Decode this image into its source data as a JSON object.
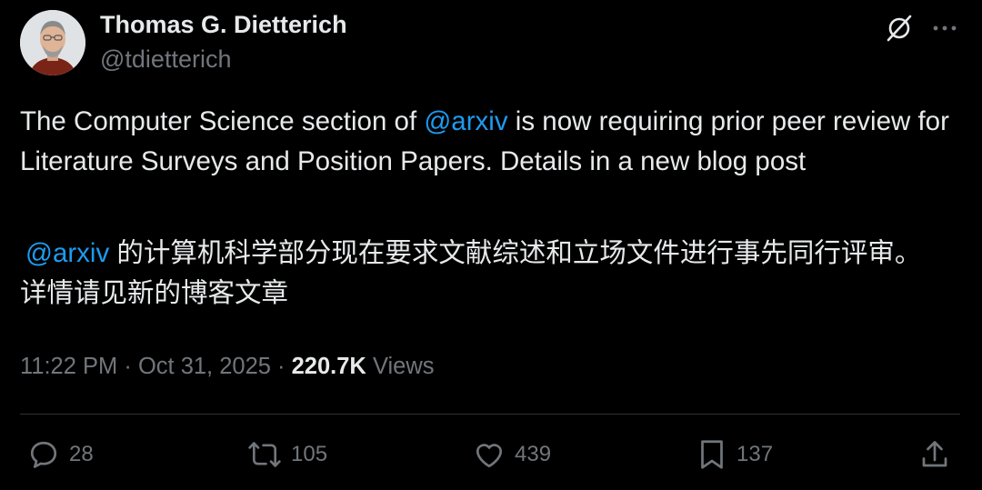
{
  "author": {
    "name": "Thomas G. Dietterich",
    "handle": "@tdietterich"
  },
  "tweet": {
    "text_prefix": "The Computer Science section of ",
    "mention": "@arxiv",
    "text_suffix": " is now requiring prior peer review for Literature Surveys and Position Papers. Details in a new blog post",
    "translation_mention": "@arxiv",
    "translation_text": " 的计算机科学部分现在要求文献综述和立场文件进行事先同行评审。详情请见新的博客文章"
  },
  "meta": {
    "time": "11:22 PM",
    "separator1": " · ",
    "date": "Oct 31, 2025",
    "separator2": " · ",
    "views_count": "220.7K",
    "views_label": " Views"
  },
  "actions": {
    "replies": "28",
    "reposts": "105",
    "likes": "439",
    "bookmarks": "137"
  },
  "icons": {
    "header": [
      "grok-icon",
      "more-icon"
    ],
    "actions": [
      "reply-icon",
      "retweet-icon",
      "like-icon",
      "bookmark-icon",
      "share-icon"
    ]
  },
  "colors": {
    "background": "#000000",
    "text": "#e7e9ea",
    "secondary": "#71767b",
    "link": "#1d9bf0",
    "divider": "#2f3336"
  }
}
